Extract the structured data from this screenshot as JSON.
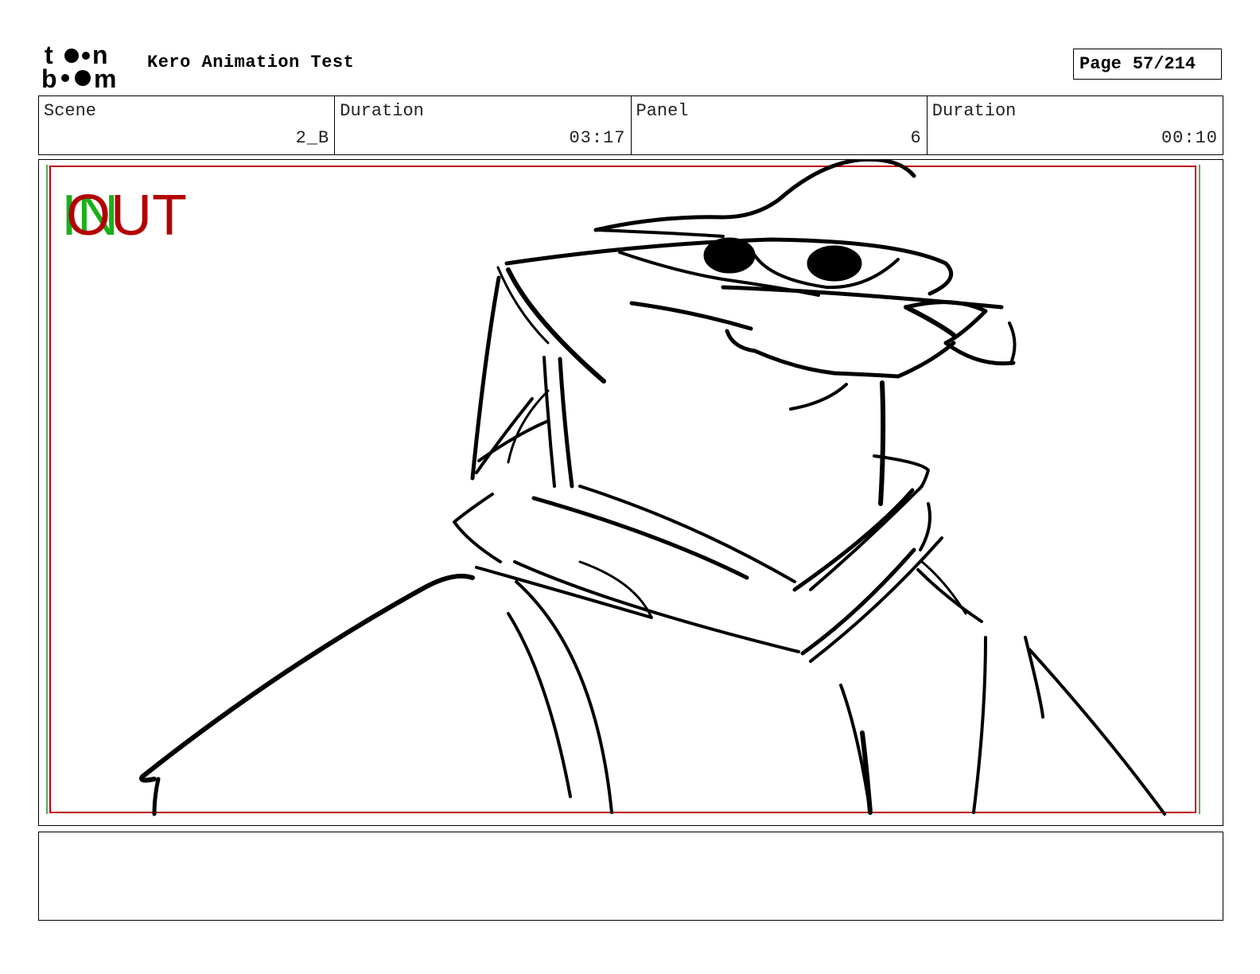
{
  "header": {
    "logo_text": "toon boom",
    "project_title": "Kero Animation Test",
    "page_label": "Page",
    "page_value": "57/214"
  },
  "info": [
    {
      "label": "Scene",
      "value": "2_B"
    },
    {
      "label": "Duration",
      "value": "03:17"
    },
    {
      "label": "Panel",
      "value": "6"
    },
    {
      "label": "Duration",
      "value": "00:10"
    }
  ],
  "panel": {
    "in_label": "IN",
    "out_label": "OUT",
    "in_color": "#19b019",
    "out_color": "#b30000",
    "safe_frame_color": "#c00000",
    "action_frame_color": "#2a8a2a"
  },
  "notes": {
    "text": ""
  }
}
